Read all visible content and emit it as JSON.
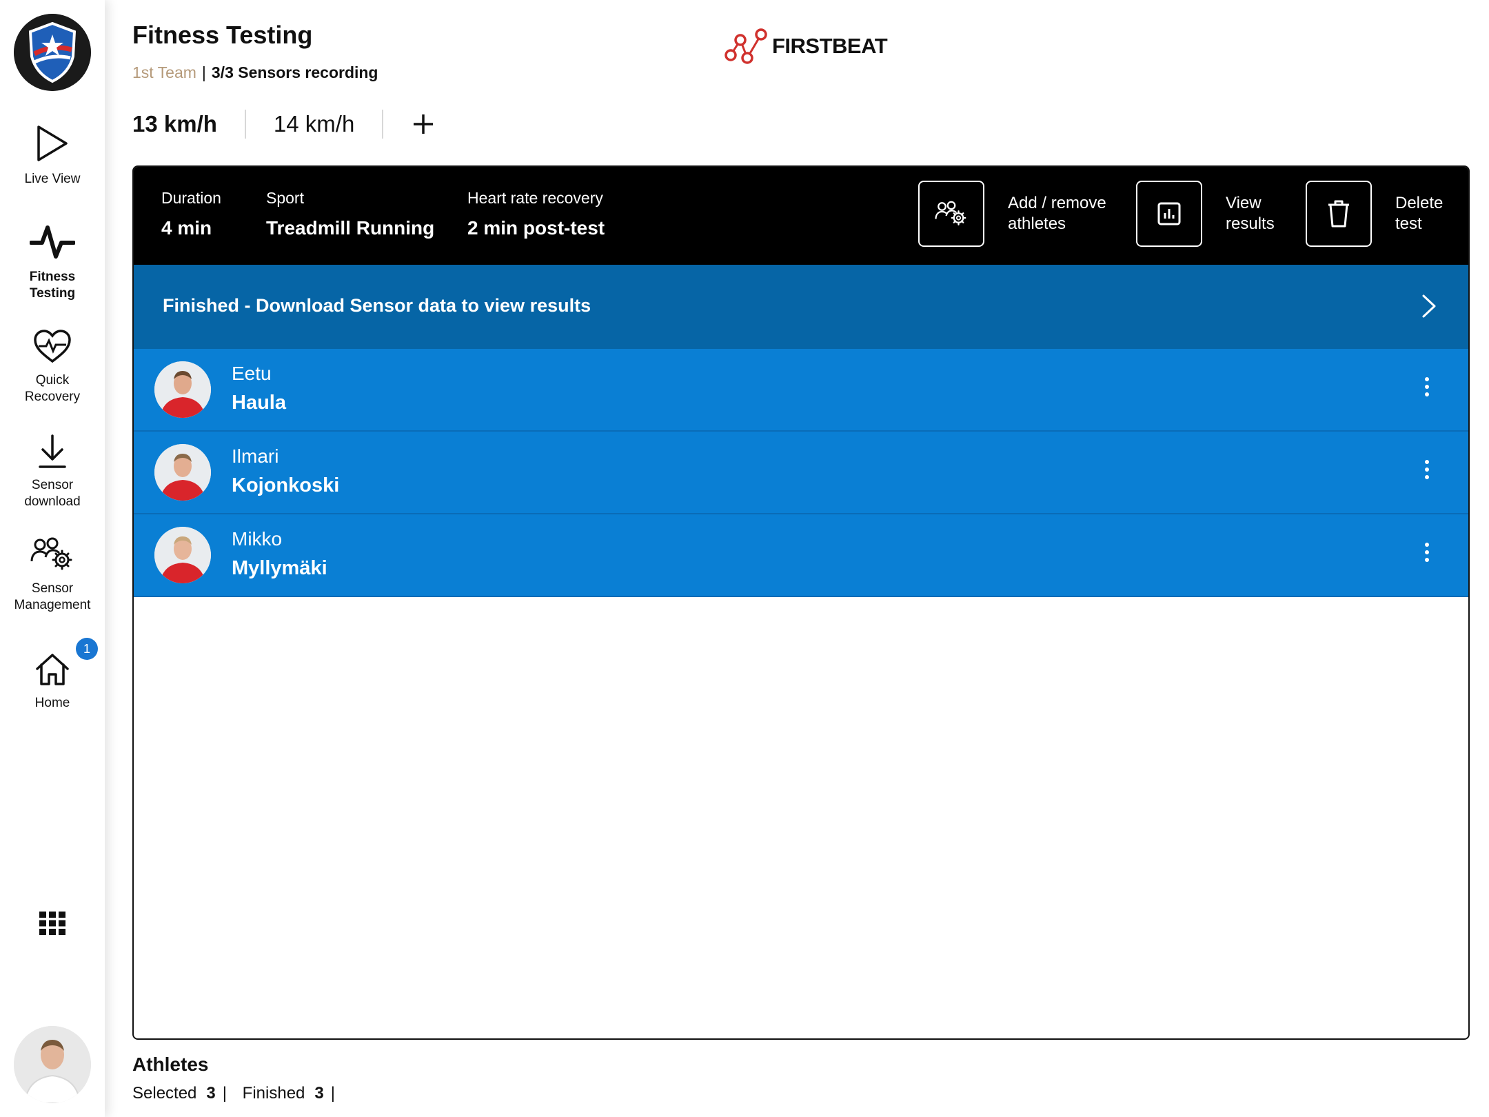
{
  "app": {
    "brand": "FIRSTBEAT"
  },
  "sidebar": {
    "items": [
      {
        "label": "Live View",
        "icon": "play-icon"
      },
      {
        "label": "Fitness\nTesting",
        "icon": "pulse-icon",
        "active": true
      },
      {
        "label": "Quick\nRecovery",
        "icon": "heart-pulse-icon"
      },
      {
        "label": "Sensor\ndownload",
        "icon": "download-icon"
      },
      {
        "label": "Sensor\nManagement",
        "icon": "group-gear-icon"
      },
      {
        "label": "Home",
        "icon": "home-icon",
        "badge": "1"
      }
    ],
    "apps_icon": "apps-grid-icon"
  },
  "header": {
    "title": "Fitness Testing",
    "team": "1st Team",
    "separator": "|",
    "sensors_status": "3/3 Sensors recording"
  },
  "speed_tabs": [
    {
      "label": "13 km/h",
      "active": true
    },
    {
      "label": "14 km/h",
      "active": false
    }
  ],
  "test_info": {
    "duration": {
      "label": "Duration",
      "value": "4 min"
    },
    "sport": {
      "label": "Sport",
      "value": "Treadmill Running"
    },
    "hr_recovery": {
      "label": "Heart rate recovery",
      "value": "2 min post-test"
    }
  },
  "actions": {
    "add_remove": "Add / remove\nathletes",
    "view_results": "View\nresults",
    "delete_test": "Delete\ntest"
  },
  "status_banner": "Finished - Download Sensor data to view results",
  "athletes": [
    {
      "first": "Eetu",
      "last": "Haula"
    },
    {
      "first": "Ilmari",
      "last": "Kojonkoski"
    },
    {
      "first": "Mikko",
      "last": "Myllymäki"
    }
  ],
  "footer": {
    "heading": "Athletes",
    "selected_label": "Selected",
    "selected_count": "3",
    "finished_label": "Finished",
    "finished_count": "3",
    "pipe": "|"
  },
  "colors": {
    "info_bar": "#000000",
    "status_banner": "#0665a6",
    "athlete_row": "#0a7fd4",
    "badge": "#1976d2",
    "brand_red": "#d0312d",
    "team_name": "#b59a7a"
  }
}
